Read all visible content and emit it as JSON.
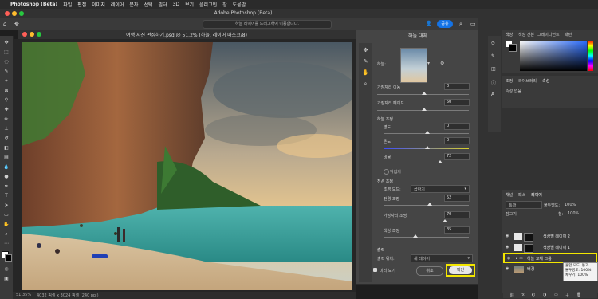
{
  "menubar": {
    "apple": "",
    "app": "Photoshop (Beta)",
    "items": [
      "파일",
      "편집",
      "이미지",
      "레이어",
      "문자",
      "선택",
      "필터",
      "3D",
      "보기",
      "플러그인",
      "창",
      "도움말"
    ]
  },
  "window": {
    "title": "Adobe Photoshop (Beta)"
  },
  "options_bar": {
    "hint": "하늘 레이어를 드래그하여 이동합니다.",
    "share_label": "공유"
  },
  "document": {
    "tab_title": "여행 사진 편집하기.psd @ 51.2% (하늘, 레이어 마스크/8)",
    "zoom": "51.35%",
    "info": "4032 픽셀 x 3024 픽셀 (240 ppi)"
  },
  "sky_dialog": {
    "title": "하늘 대체",
    "sky_label": "하늘:",
    "fields": {
      "shift_edge": {
        "label": "가장자리 이동",
        "value": "0"
      },
      "fade_edge": {
        "label": "가장자리 페이드",
        "value": "50"
      },
      "sky_adjust": "하늘 조정",
      "brightness": {
        "label": "명도",
        "value": "0"
      },
      "temperature": {
        "label": "온도",
        "value": "0"
      },
      "scale": {
        "label": "비율",
        "value": "72"
      },
      "flip": "뒤집기",
      "fg_adjust": "전경 조정",
      "light_mode": {
        "label": "조명 모드:",
        "value": "곱하기"
      },
      "fg_light": {
        "label": "전경 조명",
        "value": "52"
      },
      "edge_light": {
        "label": "가장자리 조명",
        "value": "70"
      },
      "color_adjust": {
        "label": "색상 조정",
        "value": "35"
      },
      "output": "출력",
      "output_to": {
        "label": "출력 위치:",
        "value": "새 레이어"
      }
    },
    "preview": "미리 보기",
    "cancel": "취소",
    "ok": "확인"
  },
  "right_panels": {
    "color_tabs": [
      "색상",
      "색상 견본",
      "그레이디언트",
      "패턴"
    ],
    "prop_tabs": [
      "조정",
      "라이브러리",
      "속성"
    ],
    "prop_sub": "속성 없음",
    "layer_tabs": [
      "채널",
      "패스",
      "레이어"
    ],
    "blend_mode": "통과",
    "opacity_label": "불투명도:",
    "opacity": "100%",
    "fill_label": "칠:",
    "fill": "100%",
    "lock_label": "잠그기:",
    "layers": [
      "색상별 레이어 2",
      "색상별 레이어 1",
      "하늘 교체 그룹",
      "배경"
    ],
    "tooltip": [
      "혼합 모드: 통과",
      "불투명도: 100%",
      "채우기: 100%"
    ]
  },
  "colors": {
    "accent": "#1473e6",
    "highlight": "#f3e600",
    "panel": "#3a3a3a",
    "dialog": "#454545"
  }
}
